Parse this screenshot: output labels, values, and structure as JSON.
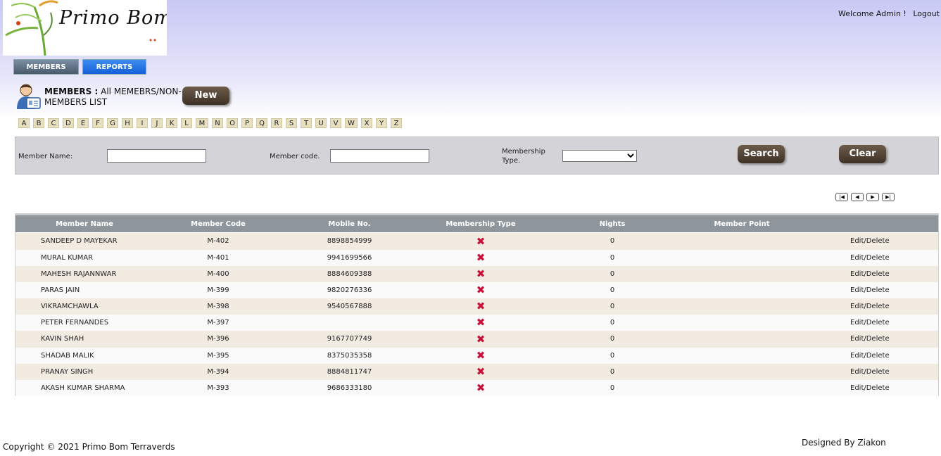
{
  "header": {
    "logo_text": "Primo Bom",
    "welcome": "Welcome Admin !",
    "logout": "Logout"
  },
  "tabs": [
    {
      "label": "MEMBERS"
    },
    {
      "label": "REPORTS"
    }
  ],
  "page": {
    "title_strong": "MEMBERS :",
    "title_rest": "All MEMEBRS/NON-MEMBERS LIST",
    "new_button": "New"
  },
  "alphabet": [
    "A",
    "B",
    "C",
    "D",
    "E",
    "F",
    "G",
    "H",
    "I",
    "J",
    "K",
    "L",
    "M",
    "N",
    "O",
    "P",
    "Q",
    "R",
    "S",
    "T",
    "U",
    "V",
    "W",
    "X",
    "Y",
    "Z"
  ],
  "search": {
    "member_name_label": "Member Name:",
    "member_name_value": "",
    "member_code_label": "Member code.",
    "member_code_value": "",
    "membership_type_label": "Membership Type.",
    "membership_type_selected": "",
    "search_button": "Search",
    "clear_button": "Clear"
  },
  "pager": [
    "|◀",
    "◀",
    "▶",
    "▶|"
  ],
  "table": {
    "columns": [
      "Member Name",
      "Member Code",
      "Mobile No.",
      "Membership Type",
      "Nights",
      "Member Point"
    ],
    "rows": [
      {
        "name": "SANDEEP D MAYEKAR",
        "code": "M-402",
        "mobile": "8898854999",
        "type_icon": "red-x-icon",
        "nights": "0",
        "point": "",
        "action": "Edit/Delete"
      },
      {
        "name": "MURAL KUMAR",
        "code": "M-401",
        "mobile": "9941699566",
        "type_icon": "red-x-icon",
        "nights": "0",
        "point": "",
        "action": "Edit/Delete"
      },
      {
        "name": "MAHESH RAJANNWAR",
        "code": "M-400",
        "mobile": "8884609388",
        "type_icon": "red-x-icon",
        "nights": "0",
        "point": "",
        "action": "Edit/Delete"
      },
      {
        "name": "PARAS JAIN",
        "code": "M-399",
        "mobile": "9820276336",
        "type_icon": "red-x-icon",
        "nights": "0",
        "point": "",
        "action": "Edit/Delete"
      },
      {
        "name": "VIKRAMCHAWLA",
        "code": "M-398",
        "mobile": "9540567888",
        "type_icon": "red-x-icon",
        "nights": "0",
        "point": "",
        "action": "Edit/Delete"
      },
      {
        "name": "PETER FERNANDES",
        "code": "M-397",
        "mobile": "",
        "type_icon": "red-x-icon",
        "nights": "0",
        "point": "",
        "action": "Edit/Delete"
      },
      {
        "name": "KAVIN SHAH",
        "code": "M-396",
        "mobile": "9167707749",
        "type_icon": "red-x-icon",
        "nights": "0",
        "point": "",
        "action": "Edit/Delete"
      },
      {
        "name": "SHADAB MALIK",
        "code": "M-395",
        "mobile": "8375035358",
        "type_icon": "red-x-icon",
        "nights": "0",
        "point": "",
        "action": "Edit/Delete"
      },
      {
        "name": "PRANAY SINGH",
        "code": "M-394",
        "mobile": "8884811747",
        "type_icon": "red-x-icon",
        "nights": "0",
        "point": "",
        "action": "Edit/Delete"
      },
      {
        "name": "AKASH KUMAR SHARMA",
        "code": "M-393",
        "mobile": "9686333180",
        "type_icon": "red-x-icon",
        "nights": "0",
        "point": "",
        "action": "Edit/Delete"
      }
    ]
  },
  "footer": {
    "copyright": "Copyright © 2021 Primo Bom Terraverds",
    "designed_by": "Designed By Ziakon"
  },
  "colors": {
    "header_gradient_top": "#c8c8f5",
    "tab_members": "#5a6b7d",
    "tab_reports": "#1f6fe6",
    "brown_button": "#4e4033",
    "grid_header": "#8e969c",
    "row_odd": "#f1ebe2",
    "status_x": "#c8103a"
  }
}
